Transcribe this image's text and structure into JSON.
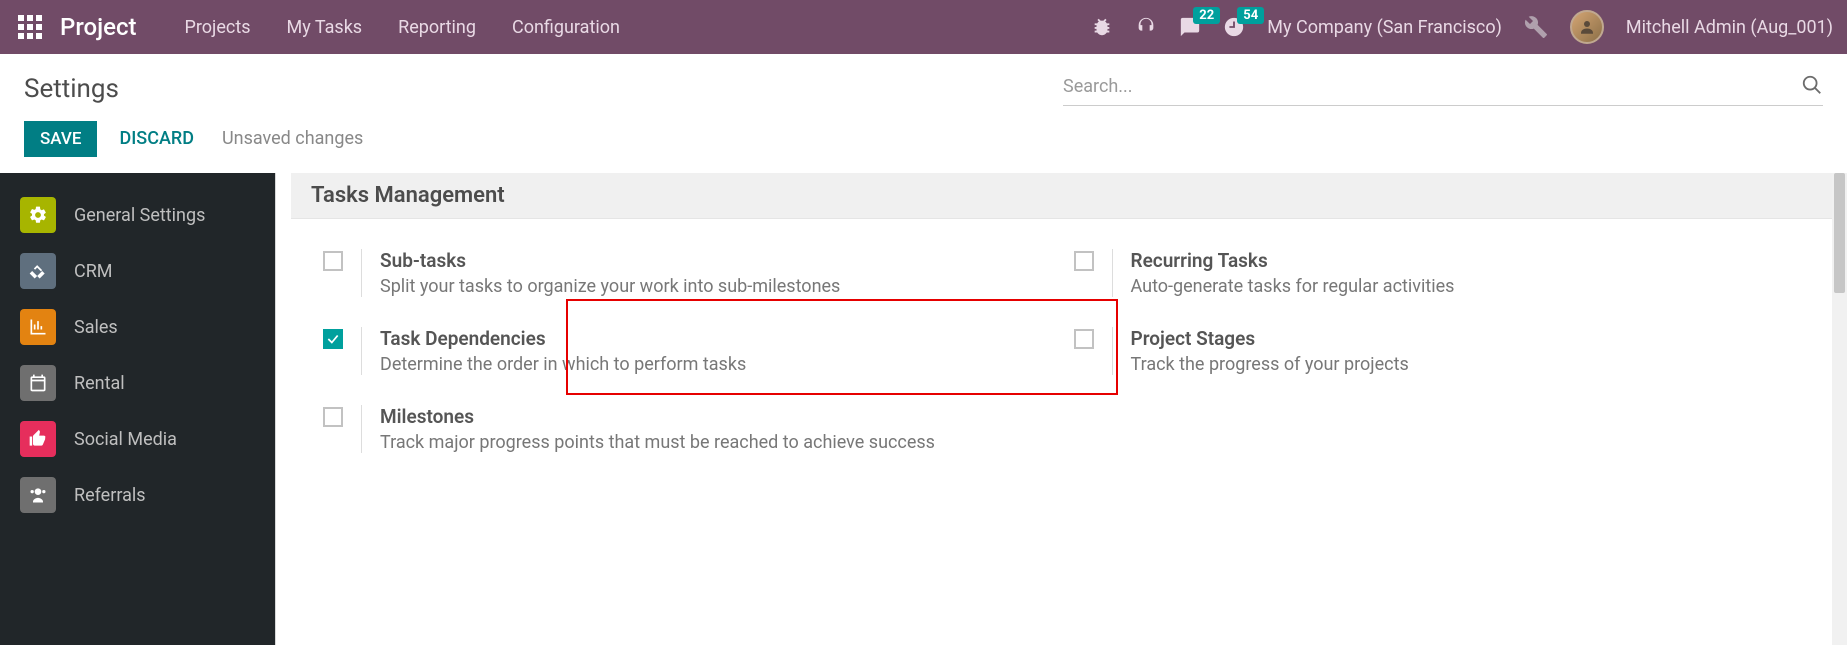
{
  "navbar": {
    "brand": "Project",
    "items": [
      "Projects",
      "My Tasks",
      "Reporting",
      "Configuration"
    ],
    "messages_badge": "22",
    "activities_badge": "54",
    "company": "My Company (San Francisco)",
    "username": "Mitchell Admin (Aug_001)"
  },
  "page": {
    "title": "Settings",
    "search_placeholder": "Search...",
    "save": "SAVE",
    "discard": "DISCARD",
    "unsaved": "Unsaved changes"
  },
  "sidebar": {
    "items": [
      {
        "label": "General Settings"
      },
      {
        "label": "CRM"
      },
      {
        "label": "Sales"
      },
      {
        "label": "Rental"
      },
      {
        "label": "Social Media"
      },
      {
        "label": "Referrals"
      }
    ]
  },
  "section": {
    "title": "Tasks Management",
    "settings": [
      {
        "title": "Sub-tasks",
        "desc": "Split your tasks to organize your work into sub-milestones",
        "checked": false
      },
      {
        "title": "Recurring Tasks",
        "desc": "Auto-generate tasks for regular activities",
        "checked": false
      },
      {
        "title": "Task Dependencies",
        "desc": "Determine the order in which to perform tasks",
        "checked": true
      },
      {
        "title": "Project Stages",
        "desc": "Track the progress of your projects",
        "checked": false
      },
      {
        "title": "Milestones",
        "desc": "Track major progress points that must be reached to achieve success",
        "checked": false
      }
    ]
  }
}
